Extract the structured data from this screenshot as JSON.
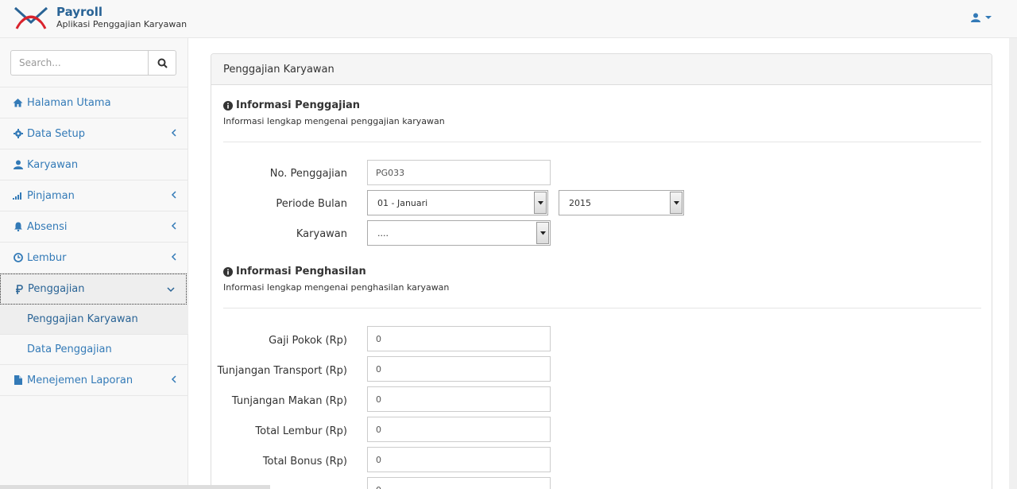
{
  "header": {
    "brand_title": "Payroll",
    "brand_subtitle": "Aplikasi Penggajian Karyawan"
  },
  "sidebar": {
    "search_placeholder": "Search...",
    "items": [
      {
        "label": "Halaman Utama",
        "icon": "home-icon"
      },
      {
        "label": "Data Setup",
        "icon": "gear-icon"
      },
      {
        "label": "Karyawan",
        "icon": "user-icon"
      },
      {
        "label": "Pinjaman",
        "icon": "signal-icon"
      },
      {
        "label": "Absensi",
        "icon": "bell-icon"
      },
      {
        "label": "Lembur",
        "icon": "clock-icon"
      },
      {
        "label": "Penggajian",
        "icon": "ruble-icon"
      },
      {
        "label": "Menejemen Laporan",
        "icon": "file-icon"
      }
    ],
    "submenu": [
      {
        "label": "Penggajian Karyawan"
      },
      {
        "label": "Data Penggajian"
      }
    ]
  },
  "panel": {
    "heading": "Penggajian Karyawan",
    "section1": {
      "title": "Informasi Penggajian",
      "subtitle": "Informasi lengkap mengenai penggajian karyawan"
    },
    "section2": {
      "title": "Informasi Penghasilan",
      "subtitle": "Informasi lengkap mengenai penghasilan karyawan"
    },
    "fields": {
      "no_label": "No. Penggajian",
      "no_value": "PG033",
      "periode_label": "Periode Bulan",
      "bulan_value": "01 - Januari",
      "tahun_value": "2015",
      "karyawan_label": "Karyawan",
      "karyawan_value": "....",
      "gaji_label": "Gaji Pokok (Rp)",
      "gaji_value": "0",
      "transport_label": "Tunjangan Transport (Rp)",
      "transport_value": "0",
      "makan_label": "Tunjangan Makan (Rp)",
      "makan_value": "0",
      "lembur_label": "Total Lembur (Rp)",
      "lembur_value": "0",
      "bonus_label": "Total Bonus (Rp)",
      "bonus_value": "0",
      "pinjaman_value": "0"
    }
  },
  "colors": {
    "link": "#337ab7",
    "brand": "#2a6496"
  }
}
